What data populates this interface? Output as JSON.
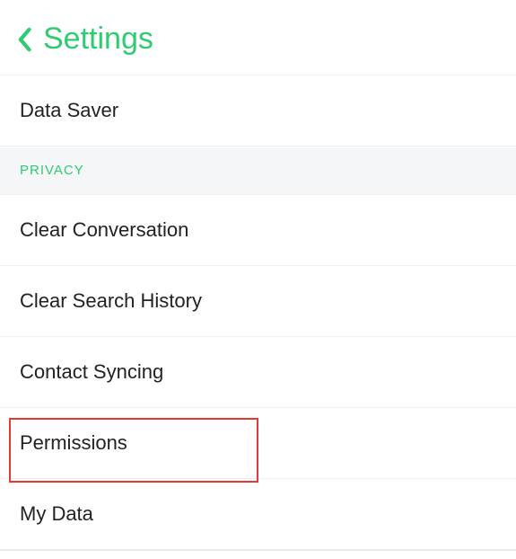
{
  "header": {
    "title": "Settings"
  },
  "sections": {
    "data_saver": "Data Saver",
    "privacy_header": "PRIVACY",
    "clear_conversation": "Clear Conversation",
    "clear_search_history": "Clear Search History",
    "contact_syncing": "Contact Syncing",
    "permissions": "Permissions",
    "my_data": "My Data"
  }
}
